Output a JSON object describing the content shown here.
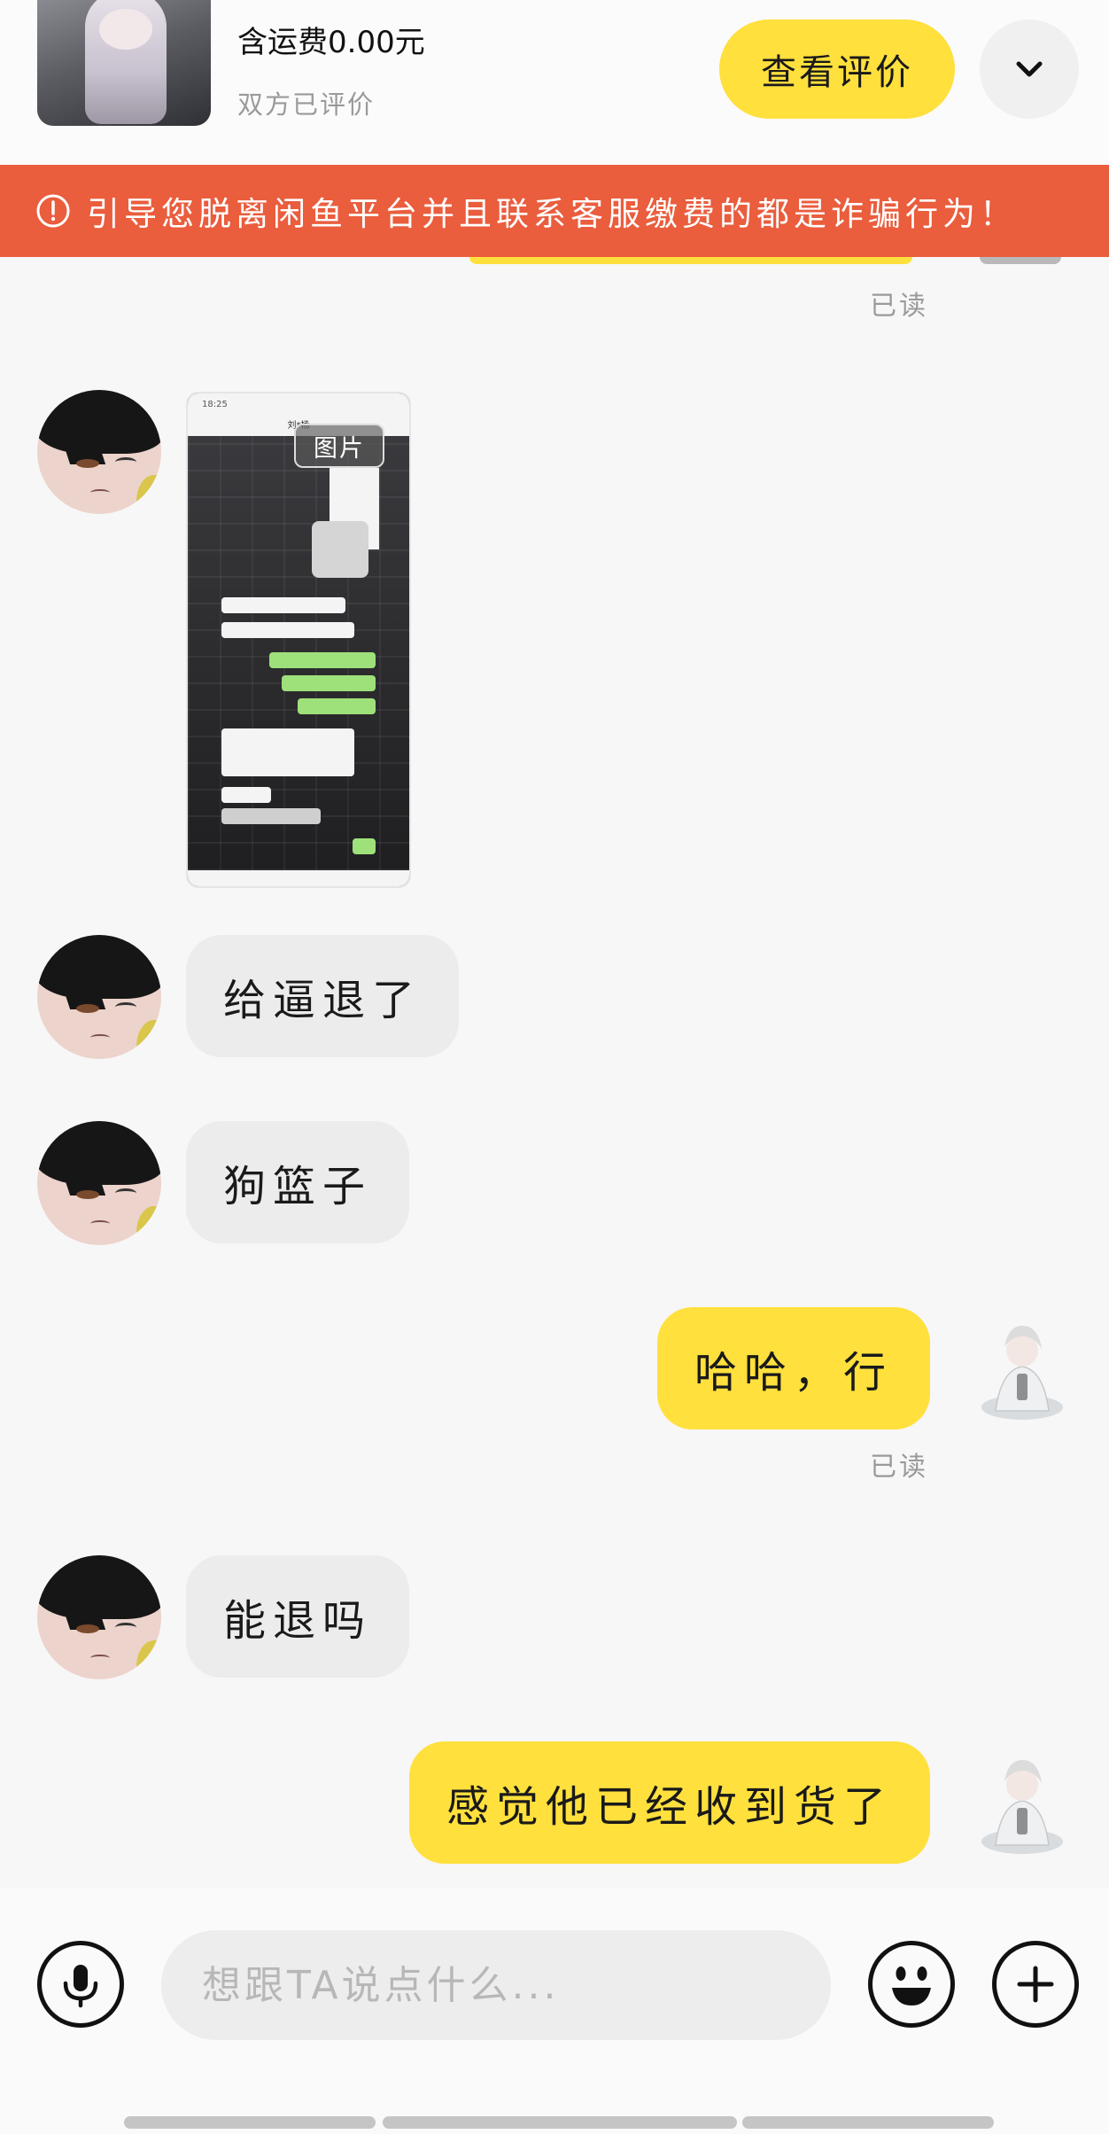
{
  "header": {
    "price_text": "含运费0.00元",
    "review_status": "双方已评价",
    "view_review_label": "查看评价",
    "collapse_icon": "chevron-down-icon"
  },
  "warning": {
    "icon": "exclamation-circle-icon",
    "text": "引导您脱离闲鱼平台并且联系客服缴费的都是诈骗行为！",
    "color": "#ea5d3d"
  },
  "chat": {
    "read_label_1": "已读",
    "image_message": {
      "tag": "图片",
      "status_time": "18:25",
      "chat_title": "刘*杨"
    },
    "messages": [
      {
        "from": "them",
        "text": "给逼退了"
      },
      {
        "from": "them",
        "text": "狗篮子"
      },
      {
        "from": "me",
        "text": "哈哈，行"
      },
      {
        "from": "them",
        "text": "能退吗"
      },
      {
        "from": "me",
        "text": "感觉他已经收到货了"
      }
    ],
    "read_label_2": "已读"
  },
  "input_bar": {
    "placeholder": "想跟TA说点什么...",
    "voice_icon": "microphone-icon",
    "emoji_icon": "emoji-icon",
    "plus_icon": "plus-icon"
  },
  "colors": {
    "accent_yellow": "#ffe03d",
    "bubble_grey": "#ececec"
  }
}
